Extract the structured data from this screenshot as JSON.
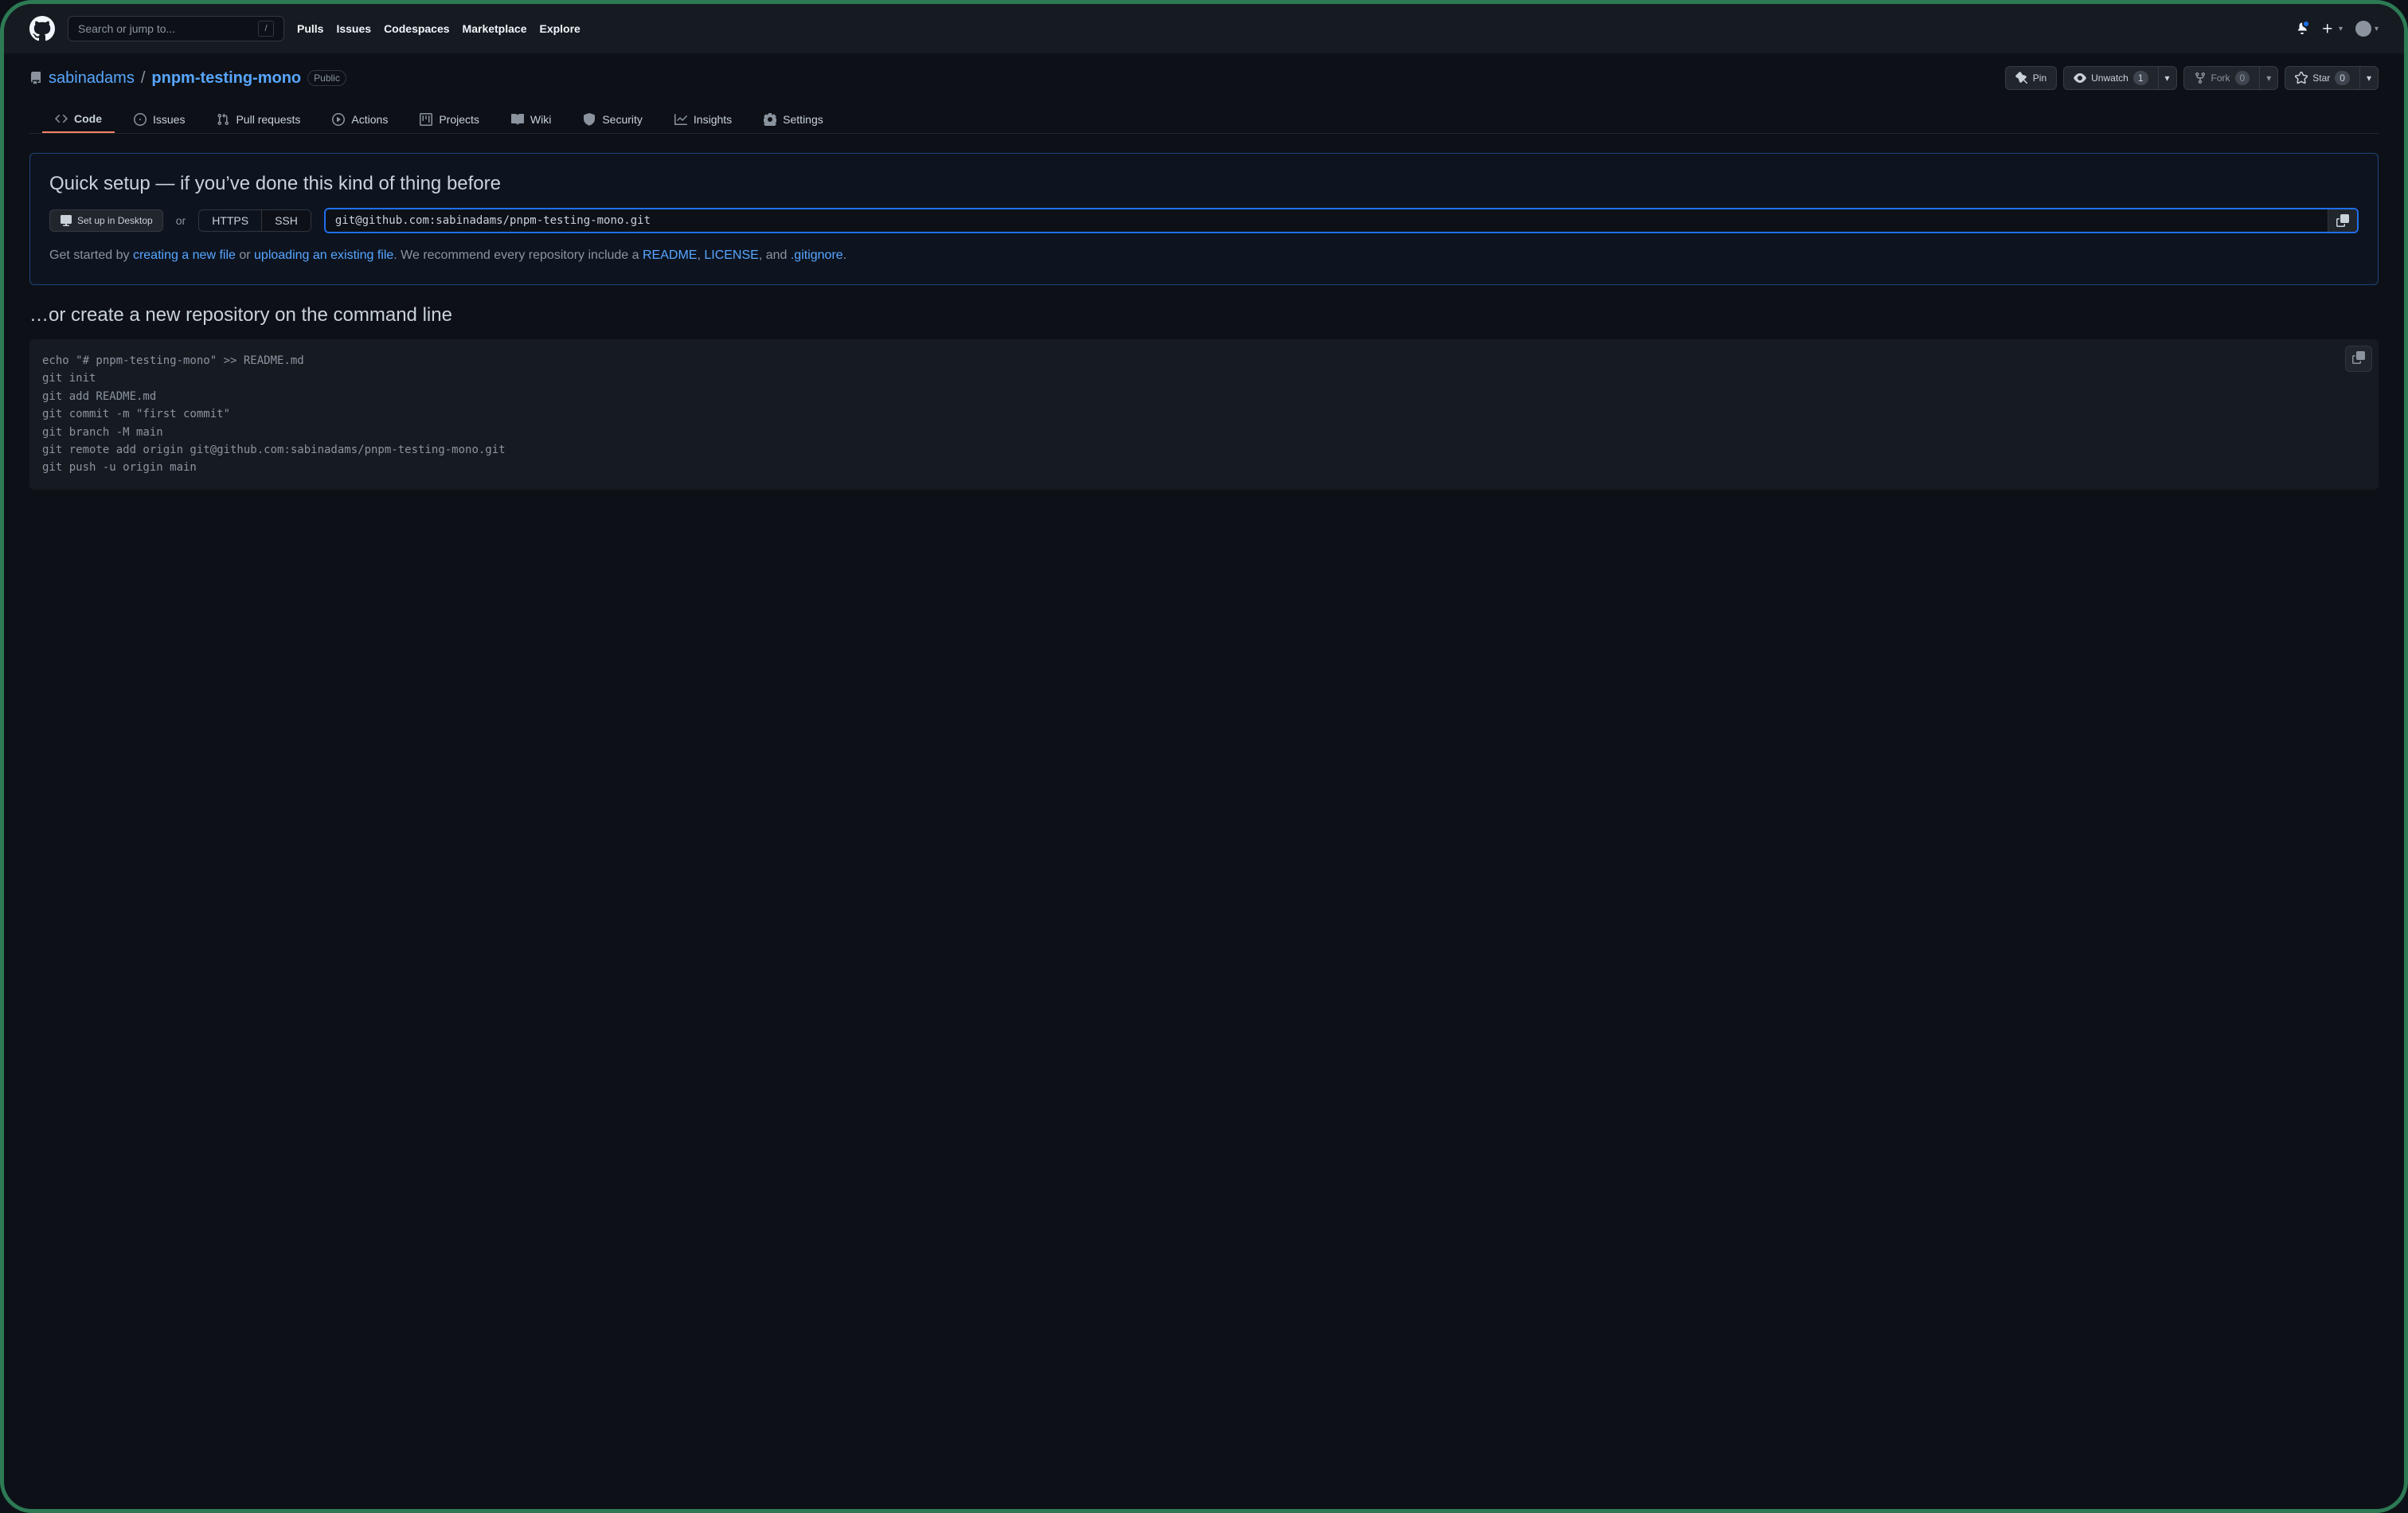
{
  "search": {
    "placeholder": "Search or jump to...",
    "slash": "/"
  },
  "topnav": [
    "Pulls",
    "Issues",
    "Codespaces",
    "Marketplace",
    "Explore"
  ],
  "repo": {
    "owner": "sabinadams",
    "name": "pnpm-testing-mono",
    "visibility": "Public"
  },
  "actions": {
    "pin": "Pin",
    "unwatch": "Unwatch",
    "watch_count": "1",
    "fork": "Fork",
    "fork_count": "0",
    "star": "Star",
    "star_count": "0"
  },
  "tabs": [
    "Code",
    "Issues",
    "Pull requests",
    "Actions",
    "Projects",
    "Wiki",
    "Security",
    "Insights",
    "Settings"
  ],
  "quick": {
    "title": "Quick setup — if you’ve done this kind of thing before",
    "desktop": "Set up in Desktop",
    "or": "or",
    "https": "HTTPS",
    "ssh": "SSH",
    "url": "git@github.com:sabinadams/pnpm-testing-mono.git",
    "line1_pre": "Get started by ",
    "link_newfile": "creating a new file",
    "line1_or": " or ",
    "link_upload": "uploading an existing file",
    "line1_post": ". We recommend every repository include a ",
    "link_readme": "README",
    "comma1": ", ",
    "link_license": "LICENSE",
    "line1_and": ", and ",
    "link_gitignore": ".gitignore",
    "period": "."
  },
  "create_section": {
    "title": "…or create a new repository on the command line",
    "code": "echo \"# pnpm-testing-mono\" >> README.md\ngit init\ngit add README.md\ngit commit -m \"first commit\"\ngit branch -M main\ngit remote add origin git@github.com:sabinadams/pnpm-testing-mono.git\ngit push -u origin main"
  }
}
